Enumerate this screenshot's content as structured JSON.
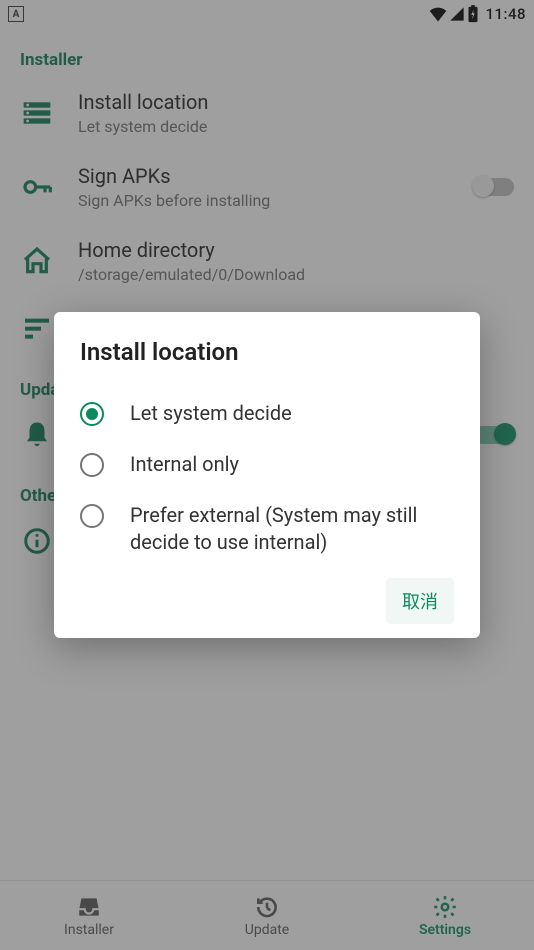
{
  "status": {
    "time": "11:48",
    "a_badge": "A"
  },
  "sections": {
    "installer": {
      "header": "Installer",
      "install_location": {
        "title": "Install location",
        "sub": "Let system decide"
      },
      "sign_apks": {
        "title": "Sign APKs",
        "sub": "Sign APKs before installing",
        "enabled": false
      },
      "home_dir": {
        "title": "Home directory",
        "sub": "/storage/emulated/0/Download"
      },
      "sort": {
        "title": ""
      }
    },
    "updates": {
      "header": "Updates",
      "notify": {
        "title": "",
        "enabled": true
      }
    },
    "other": {
      "header": "Other",
      "about": {
        "title": "About"
      }
    }
  },
  "nav": {
    "installer": "Installer",
    "update": "Update",
    "settings": "Settings"
  },
  "dialog": {
    "title": "Install location",
    "options": [
      "Let system decide",
      "Internal only",
      "Prefer external (System may still decide to use internal)"
    ],
    "selected_index": 0,
    "cancel": "取消"
  },
  "colors": {
    "accent": "#0b8a5e"
  }
}
